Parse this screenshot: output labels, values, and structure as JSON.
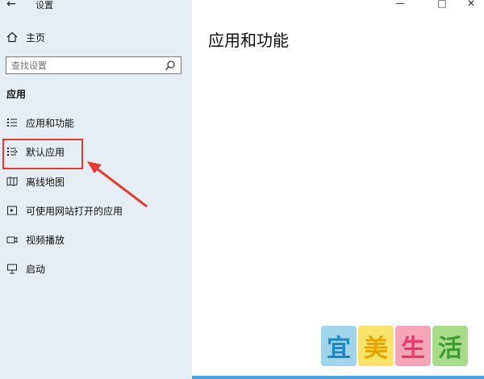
{
  "window": {
    "title": "设置",
    "back_icon": "back-arrow-icon",
    "controls": {
      "minimize": "—",
      "maximize": "□",
      "close": "✕"
    }
  },
  "sidebar": {
    "home_label": "主页",
    "search_placeholder": "查找设置",
    "section_title": "应用",
    "items": [
      {
        "label": "应用和功能",
        "icon": "apps-list-icon"
      },
      {
        "label": "默认应用",
        "icon": "default-apps-icon",
        "highlighted": true
      },
      {
        "label": "离线地图",
        "icon": "offline-map-icon"
      },
      {
        "label": "可使用网站打开的应用",
        "icon": "website-apps-icon"
      },
      {
        "label": "视频播放",
        "icon": "video-playback-icon"
      },
      {
        "label": "启动",
        "icon": "startup-icon"
      }
    ]
  },
  "main": {
    "page_title": "应用和功能"
  },
  "watermark": {
    "chars": [
      "宜",
      "美",
      "生",
      "活"
    ]
  },
  "colors": {
    "sidebar_bg": "#e6edf3",
    "highlight": "#e53935",
    "watermark_bg": [
      "#9fd4ea",
      "#f9e36b",
      "#f6a4b8",
      "#a8dc8b"
    ],
    "watermark_fg": [
      "#1e88c7",
      "#e8a400",
      "#e53970",
      "#3e9b2d"
    ]
  }
}
